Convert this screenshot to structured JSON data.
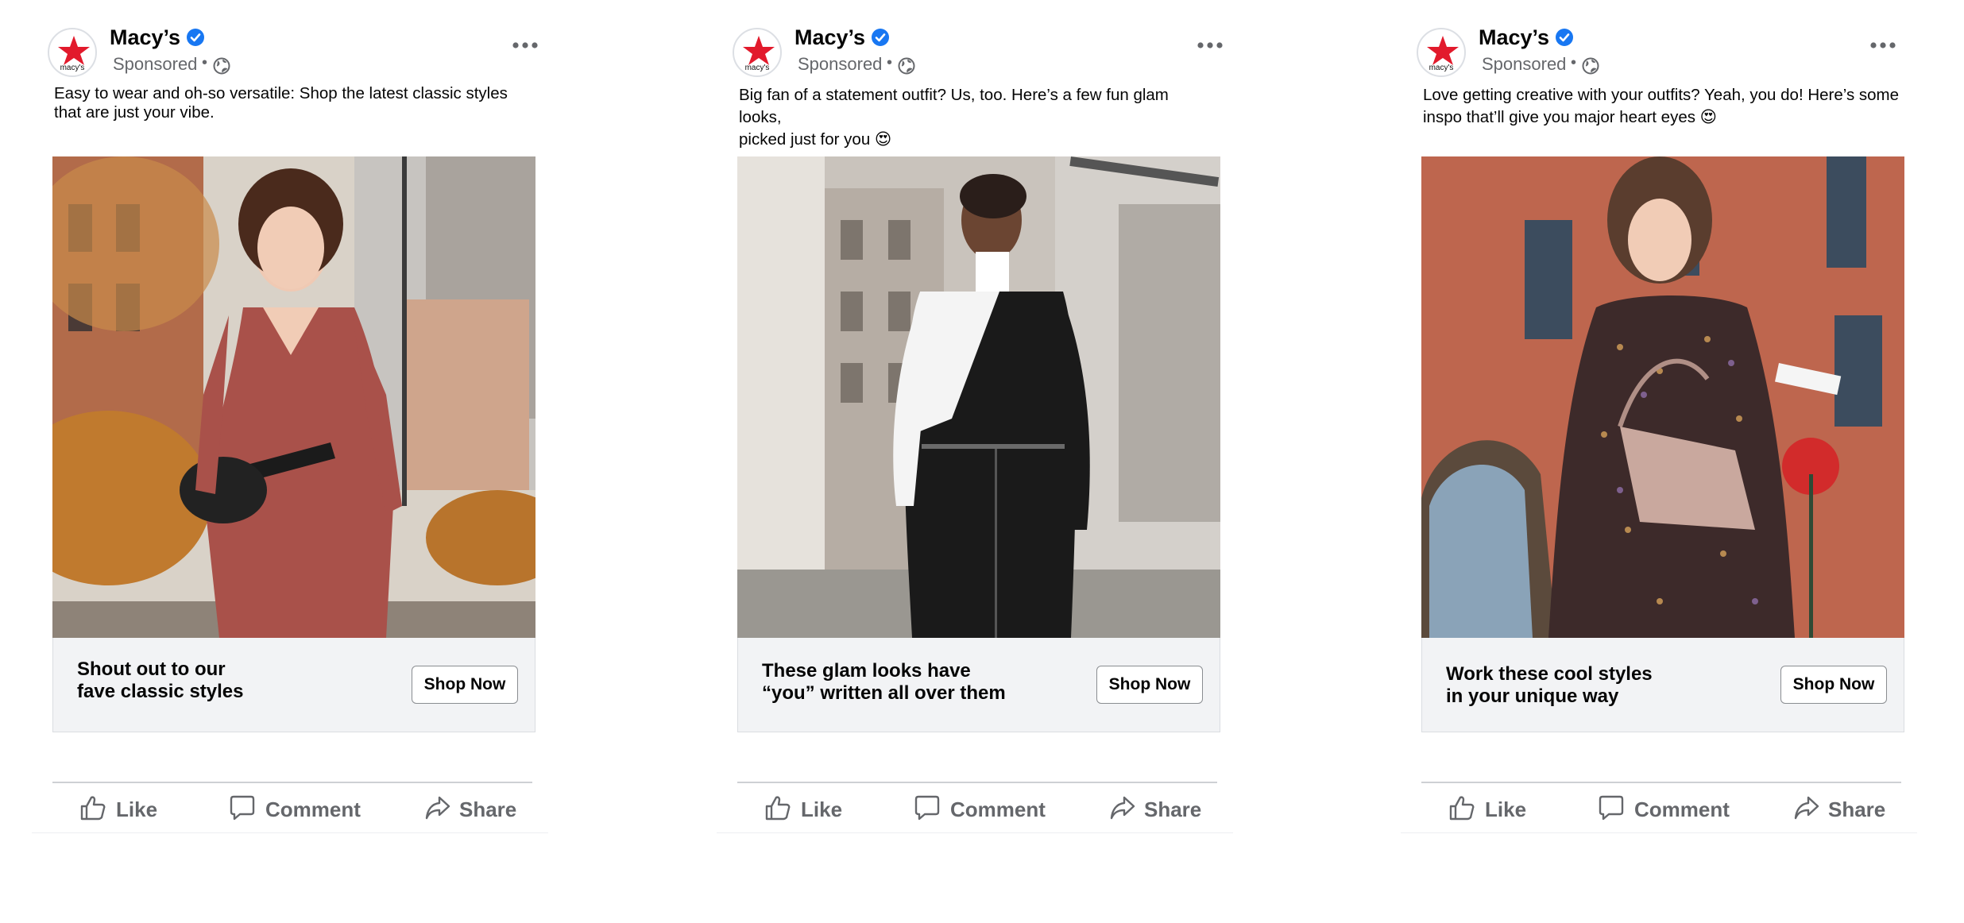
{
  "posts": [
    {
      "page_name": "Macy’s",
      "avatar_text": "macy's",
      "sponsored": "Sponsored",
      "caption_lines": [
        "Easy to wear and oh-so versatile: Shop the latest classic styles",
        "that are just your vibe."
      ],
      "headline_lines": [
        "Shout out to our",
        "fave classic styles"
      ],
      "cta_label": "Shop Now",
      "photo_subject": "woman in rust knit dress with black belt bag on city street"
    },
    {
      "page_name": "Macy’s",
      "avatar_text": "macy's",
      "sponsored": "Sponsored",
      "caption_lines": [
        "Big fan of a statement outfit? Us, too. Here’s a few fun glam looks,",
        "picked just for you 😍"
      ],
      "headline_lines": [
        "These glam looks have",
        "“you” written all over them"
      ],
      "cta_label": "Shop Now",
      "photo_subject": "woman in black and white color-block turtleneck dress among city buildings"
    },
    {
      "page_name": "Macy’s",
      "avatar_text": "macy's",
      "sponsored": "Sponsored",
      "caption_lines": [
        "Love getting creative with your outfits? Yeah, you do! Here’s some",
        "inspo that’ll give you major heart eyes 😍"
      ],
      "headline_lines": [
        "Work these cool styles",
        "in your unique way"
      ],
      "cta_label": "Shop Now",
      "photo_subject": "woman in printed dress with pink quilted handbag by brick building"
    }
  ],
  "actions": {
    "like": "Like",
    "comment": "Comment",
    "share": "Share"
  },
  "colors": {
    "brand_red": "#e21a2c",
    "verified_blue": "#1877f2",
    "muted_text": "#65676b",
    "cta_bg": "#f2f3f5"
  },
  "icons": [
    "macys-star-icon",
    "verified-badge-icon",
    "globe-icon",
    "more-options-icon",
    "like-icon",
    "comment-icon",
    "share-icon"
  ]
}
